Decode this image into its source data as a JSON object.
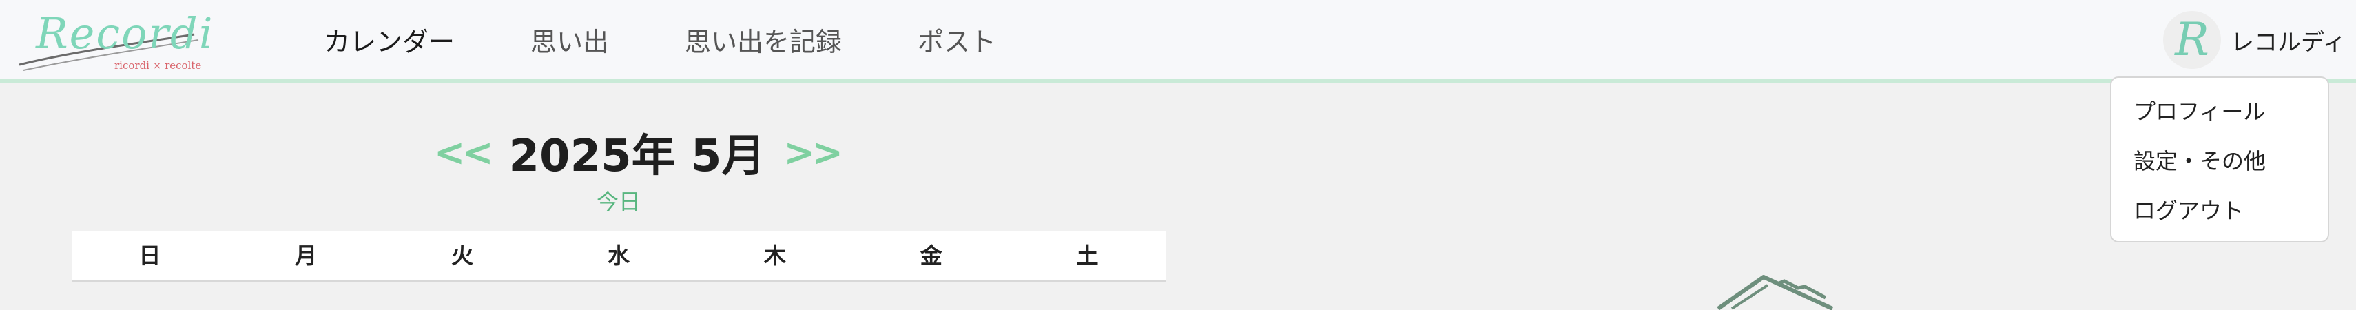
{
  "brand": {
    "logo_text": "Recordi",
    "logo_subtitle": "ricordi × recolte",
    "accent": "#7fd6b9",
    "accent_red": "#d9646b"
  },
  "nav": {
    "items": [
      "カレンダー",
      "思い出",
      "思い出を記録",
      "ポスト"
    ],
    "active_index": 0
  },
  "user": {
    "avatar_letter": "R",
    "name": "レコルディ"
  },
  "dropdown": {
    "items": [
      "プロフィール",
      "設定・その他",
      "ログアウト"
    ]
  },
  "calendar": {
    "prev_label": "<<",
    "next_label": ">>",
    "month_title": "2025年 5月",
    "today_label": "今日",
    "weekdays": [
      "日",
      "月",
      "火",
      "水",
      "木",
      "金",
      "土"
    ],
    "arrow_color": "#7fd0a0",
    "today_color": "#58b67f"
  }
}
